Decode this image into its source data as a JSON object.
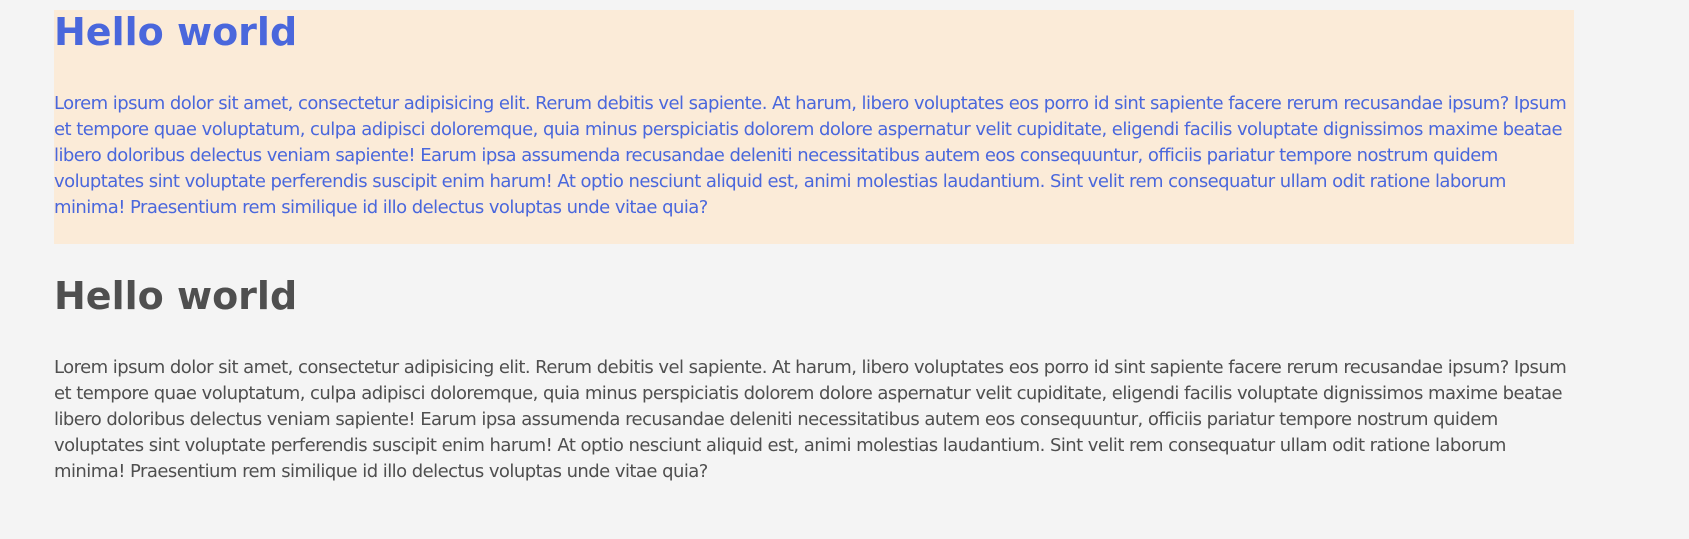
{
  "colors": {
    "page_background": "#f4f4f4",
    "highlight_background": "#fbebd8",
    "highlight_text": "#4a67dc",
    "plain_text": "#4f4f4f"
  },
  "sections": [
    {
      "heading": "Hello world",
      "paragraph": "Lorem ipsum dolor sit amet, consectetur adipisicing elit. Rerum debitis vel sapiente. At harum, libero voluptates eos porro id sint sapiente facere rerum recusandae ipsum? Ipsum et tempore quae voluptatum, culpa adipisci doloremque, quia minus perspiciatis dolorem dolore aspernatur velit cupiditate, eligendi facilis voluptate dignissimos maxime beatae libero doloribus delectus veniam sapiente! Earum ipsa assumenda recusandae deleniti necessitatibus autem eos consequuntur, officiis pariatur tempore nostrum quidem voluptates sint voluptate perferendis suscipit enim harum! At optio nesciunt aliquid est, animi molestias laudantium. Sint velit rem consequatur ullam odit ratione laborum minima! Praesentium rem similique id illo delectus voluptas unde vitae quia?"
    },
    {
      "heading": "Hello world",
      "paragraph": "Lorem ipsum dolor sit amet, consectetur adipisicing elit. Rerum debitis vel sapiente. At harum, libero voluptates eos porro id sint sapiente facere rerum recusandae ipsum? Ipsum et tempore quae voluptatum, culpa adipisci doloremque, quia minus perspiciatis dolorem dolore aspernatur velit cupiditate, eligendi facilis voluptate dignissimos maxime beatae libero doloribus delectus veniam sapiente! Earum ipsa assumenda recusandae deleniti necessitatibus autem eos consequuntur, officiis pariatur tempore nostrum quidem voluptates sint voluptate perferendis suscipit enim harum! At optio nesciunt aliquid est, animi molestias laudantium. Sint velit rem consequatur ullam odit ratione laborum minima! Praesentium rem similique id illo delectus voluptas unde vitae quia?"
    }
  ]
}
